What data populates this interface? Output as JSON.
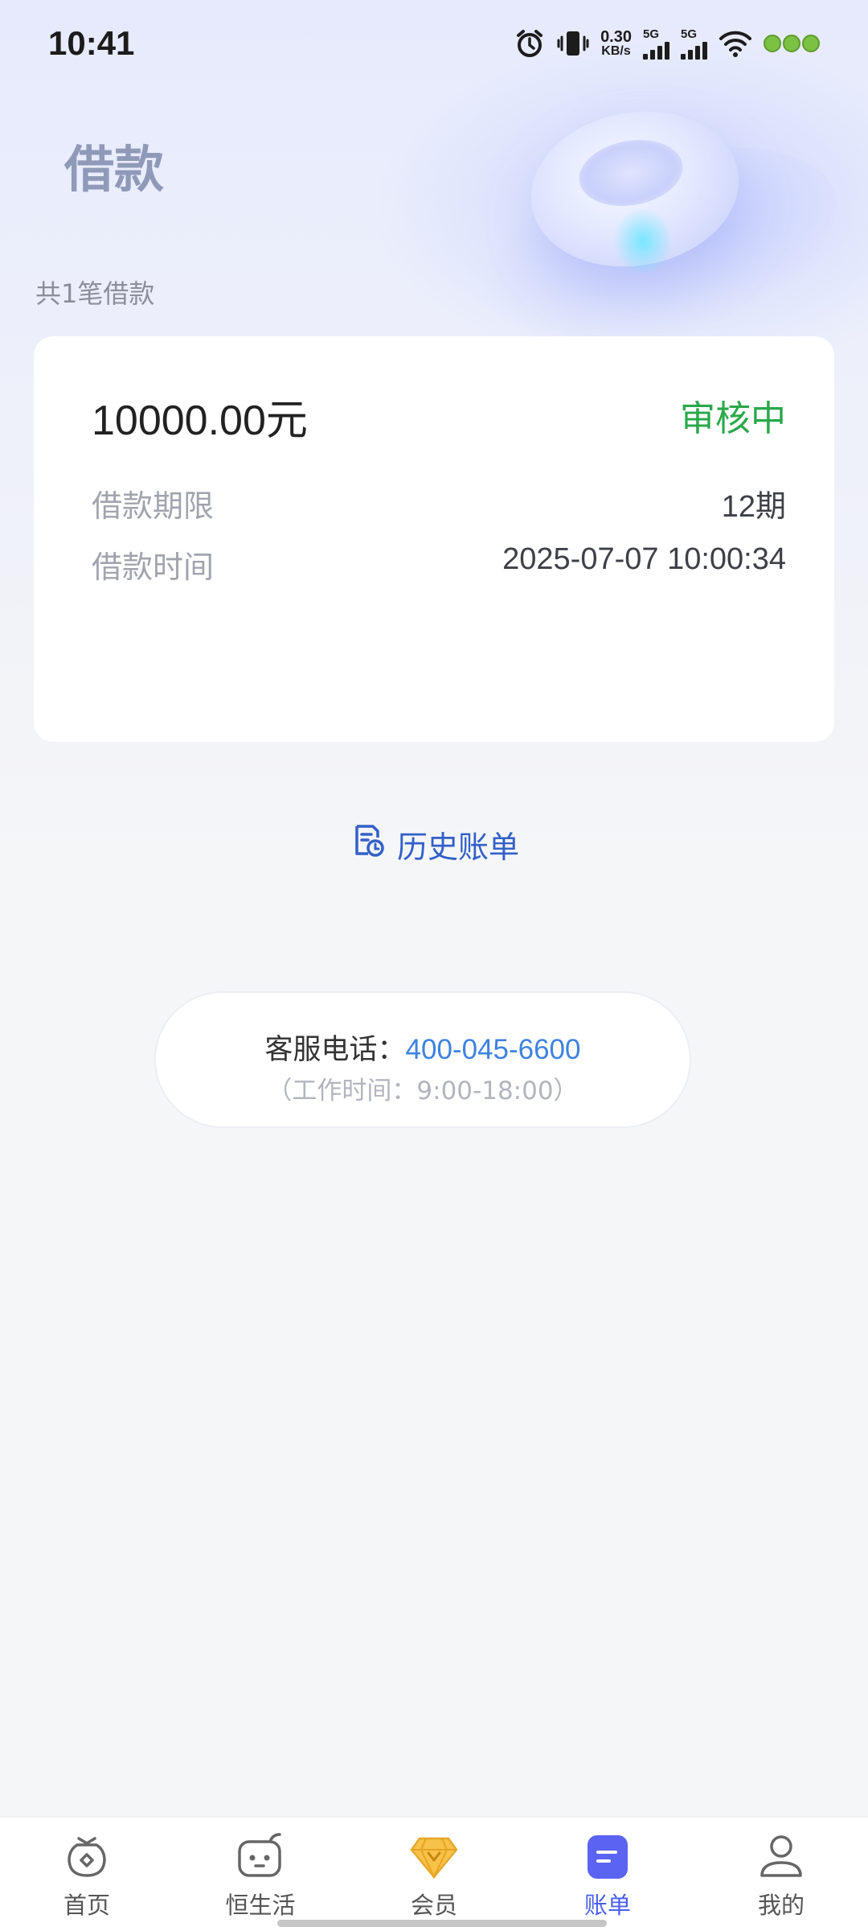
{
  "status_bar": {
    "time": "10:41",
    "net_speed_value": "0.30",
    "net_speed_unit": "KB/s",
    "sim1_label": "5G",
    "sim2_label": "5G",
    "icons": [
      "alarm-icon",
      "vibrate-icon",
      "signal-icon",
      "signal-icon",
      "wifi-icon",
      "battery-icon"
    ]
  },
  "page": {
    "title": "借款",
    "loan_count": "共1笔借款"
  },
  "loan_card": {
    "amount": "10000.00元",
    "status": "审核中",
    "status_color": "#2aa84a",
    "term_label": "借款期限",
    "term_value": "12期",
    "time_label": "借款时间",
    "time_value": "2025-07-07 10:00:34"
  },
  "history": {
    "label": "历史账单",
    "icon": "bill-history-icon"
  },
  "service": {
    "label": "客服电话：",
    "phone": "400-045-6600",
    "hours": "（工作时间：9:00-18:00）"
  },
  "tabbar": {
    "active_color": "#4a5ff0",
    "items": [
      {
        "label": "首页",
        "icon": "home-bag-icon"
      },
      {
        "label": "恒生活",
        "icon": "life-face-icon"
      },
      {
        "label": "会员",
        "icon": "diamond-icon"
      },
      {
        "label": "账单",
        "icon": "bill-icon"
      },
      {
        "label": "我的",
        "icon": "profile-icon"
      }
    ]
  }
}
